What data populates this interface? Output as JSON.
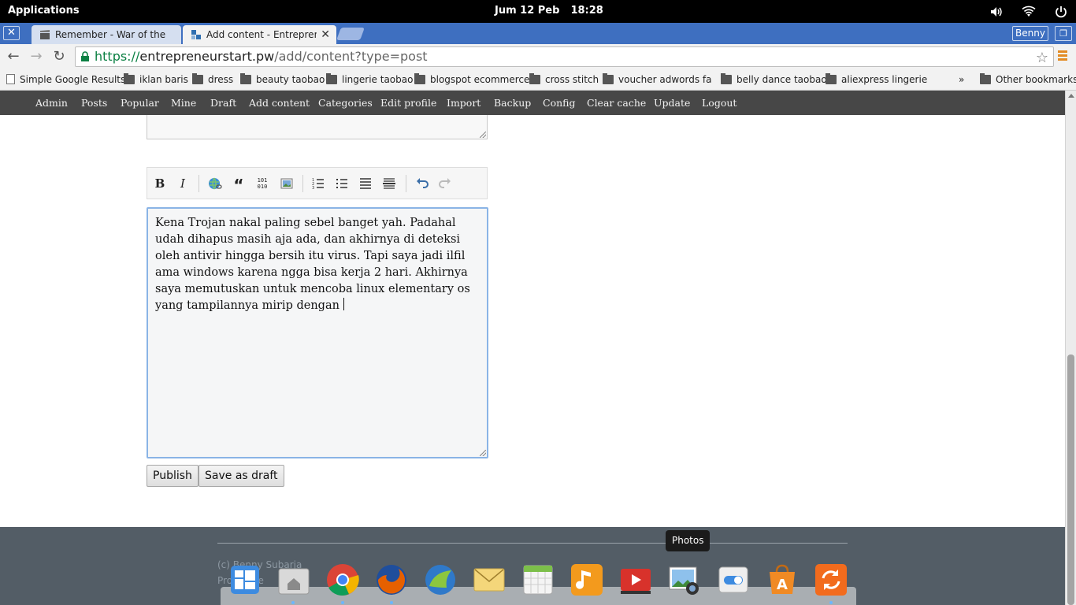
{
  "system_panel": {
    "applications": "Applications",
    "date": "Jum 12 Peb",
    "time": "18:28",
    "indicators": [
      "volume-icon",
      "wifi-icon",
      "power-icon"
    ]
  },
  "browser": {
    "tabs": [
      {
        "title": "Remember - War of the Sc",
        "icon": "clapperboard-icon",
        "active": false
      },
      {
        "title": "Add content - Entrepreneu",
        "icon": "puzzle-favicon-icon",
        "active": true
      }
    ],
    "profile": "Benny",
    "url": {
      "scheme": "https://",
      "host": "entrepreneurstart.pw",
      "path": "/add/content?type=post"
    },
    "bookmarks": [
      {
        "label": "Simple Google Results",
        "type": "page"
      },
      {
        "label": "iklan baris",
        "type": "folder"
      },
      {
        "label": "dress",
        "type": "folder"
      },
      {
        "label": "beauty taobao",
        "type": "folder"
      },
      {
        "label": "lingerie taobao",
        "type": "folder"
      },
      {
        "label": "blogspot ecommerce",
        "type": "folder"
      },
      {
        "label": "cross stitch",
        "type": "folder"
      },
      {
        "label": "voucher adwords face",
        "type": "folder"
      },
      {
        "label": "belly dance taobao",
        "type": "folder"
      },
      {
        "label": "aliexpress lingerie",
        "type": "folder"
      }
    ],
    "bookmarks_overflow": "»",
    "other_bookmarks": "Other bookmarks"
  },
  "site_nav": [
    "Admin",
    "Posts",
    "Popular",
    "Mine",
    "Draft",
    "Add content",
    "Categories",
    "Edit profile",
    "Import",
    "Backup",
    "Config",
    "Clear cache",
    "Update",
    "Logout"
  ],
  "editor": {
    "toolbar": [
      "bold",
      "italic",
      "link",
      "quote",
      "code",
      "image",
      "ordered-list",
      "unordered-list",
      "heading",
      "horizontal-rule",
      "undo",
      "redo"
    ],
    "bold_glyph": "B",
    "italic_glyph": "I",
    "quote_glyph": "“",
    "code_glyph": "101 010",
    "text": "Kena Trojan nakal paling sebel banget yah. Padahal udah dihapus masih aja ada, dan akhirnya di deteksi oleh antivir hingga bersih itu virus. Tapi saya jadi ilfil ama windows karena ngga bisa kerja 2 hari. Akhirnya saya memutuskan untuk mencoba linux elementary os yang tampilannya mirip dengan"
  },
  "buttons": {
    "publish": "Publish",
    "save_draft": "Save as draft"
  },
  "footer": {
    "copyright": "(c) Benny Subarja",
    "powered": "Pro    owe     HTM"
  },
  "dock": {
    "tooltip": "Photos",
    "apps": [
      "multitasking-view-icon",
      "files-icon",
      "chrome-icon",
      "firefox-icon",
      "midori-icon",
      "mail-icon",
      "calendar-icon",
      "music-icon",
      "videos-icon",
      "photos-icon",
      "switchboard-icon",
      "software-center-icon",
      "updater-icon"
    ]
  },
  "colors": {
    "tab_strip": "#3e6fc0",
    "site_nav": "#474747",
    "footer": "#535d66",
    "url_scheme": "#0b8043",
    "editor_focus": "#8ab4e6"
  }
}
